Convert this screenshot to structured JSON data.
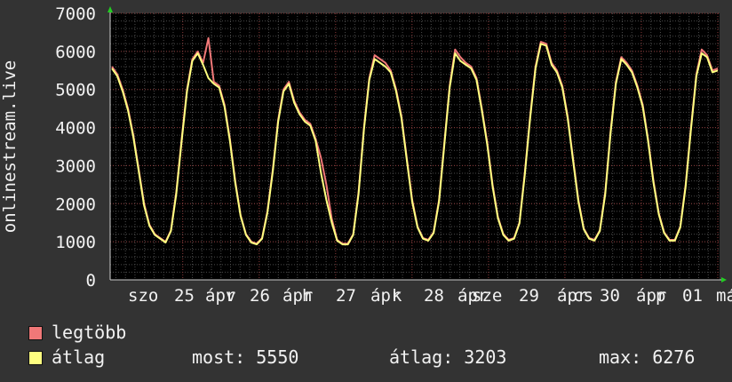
{
  "chart_data": {
    "type": "line",
    "ylabel": "onlinestream.live",
    "yticks": [
      0,
      1000,
      2000,
      3000,
      4000,
      5000,
      6000,
      7000
    ],
    "ylim": [
      0,
      7000
    ],
    "xtick_labels": [
      "szo",
      "25",
      "ápr",
      "v",
      "26",
      "ápr",
      "h",
      "27",
      "ápr",
      "k",
      "28",
      "ápr",
      "sze",
      "29",
      "ápr",
      "cs",
      "30",
      "ápr",
      "p",
      "01",
      "máj"
    ],
    "grid": true,
    "legend_position": "bottom-left",
    "series": [
      {
        "name": "legtöbb",
        "color": "#f07878",
        "values": [
          5600,
          5400,
          5000,
          4500,
          3800,
          2900,
          2000,
          1450,
          1200,
          1100,
          1000,
          1300,
          2300,
          3700,
          5000,
          5800,
          6000,
          5700,
          6350,
          5200,
          5100,
          4600,
          3700,
          2600,
          1700,
          1200,
          1000,
          950,
          1100,
          1800,
          2900,
          4200,
          5000,
          5200,
          4700,
          4400,
          4200,
          4100,
          3700,
          3200,
          2500,
          1600,
          1050,
          950,
          950,
          1200,
          2300,
          4000,
          5300,
          5900,
          5800,
          5700,
          5500,
          5000,
          4300,
          3200,
          2100,
          1400,
          1100,
          1050,
          1250,
          2100,
          3600,
          5100,
          6050,
          5850,
          5700,
          5600,
          5300,
          4500,
          3600,
          2500,
          1650,
          1200,
          1050,
          1100,
          1500,
          2800,
          4300,
          5600,
          6250,
          6200,
          5700,
          5500,
          5100,
          4300,
          3200,
          2100,
          1350,
          1100,
          1050,
          1300,
          2300,
          3900,
          5200,
          5850,
          5700,
          5500,
          5100,
          4600,
          3700,
          2600,
          1750,
          1250,
          1050,
          1050,
          1400,
          2500,
          4000,
          5400,
          6050,
          5900,
          5500,
          5550
        ]
      },
      {
        "name": "átlag",
        "color": "#ffff80",
        "values": [
          5550,
          5350,
          4950,
          4450,
          3750,
          2850,
          1950,
          1420,
          1180,
          1080,
          980,
          1280,
          2250,
          3650,
          4950,
          5750,
          5950,
          5650,
          5300,
          5150,
          5050,
          4550,
          3650,
          2550,
          1680,
          1180,
          980,
          930,
          1080,
          1760,
          2850,
          4150,
          4950,
          5150,
          4650,
          4350,
          4150,
          4050,
          3650,
          2800,
          2100,
          1500,
          1030,
          930,
          930,
          1180,
          2250,
          3950,
          5250,
          5800,
          5700,
          5600,
          5450,
          4950,
          4250,
          3150,
          2050,
          1380,
          1080,
          1030,
          1230,
          2050,
          3550,
          5050,
          5950,
          5750,
          5650,
          5550,
          5250,
          4450,
          3550,
          2450,
          1620,
          1180,
          1030,
          1080,
          1480,
          2750,
          4250,
          5550,
          6200,
          6150,
          5650,
          5450,
          5050,
          4250,
          3150,
          2050,
          1330,
          1080,
          1030,
          1280,
          2250,
          3850,
          5150,
          5800,
          5650,
          5450,
          5050,
          4550,
          3650,
          2550,
          1720,
          1230,
          1030,
          1030,
          1380,
          2450,
          3950,
          5350,
          5950,
          5850,
          5450,
          5500
        ]
      }
    ]
  },
  "legend": {
    "max_label": "legtöbb",
    "avg_label": "átlag",
    "stats": {
      "now": "most: 5550",
      "avg": "átlag: 3203",
      "max": "max: 6276"
    }
  }
}
